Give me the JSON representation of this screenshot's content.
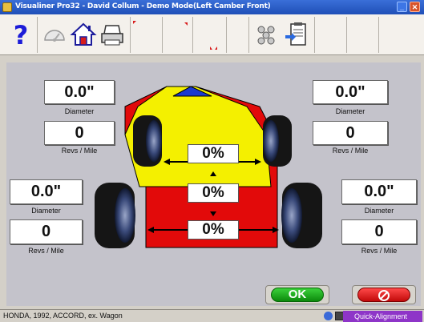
{
  "window": {
    "title": "Visualiner Pro32 - David Collum - Demo Mode(Left Camber Front)"
  },
  "toolbar": {
    "items": [
      "help-icon",
      "gauge-icon",
      "home-icon",
      "printer-icon",
      "tire-runout-icon",
      "specifications-icon"
    ]
  },
  "wheels": {
    "front_left": {
      "diameter": "0.0\"",
      "diameter_label": "Diameter",
      "revs": "0",
      "revs_label": "Revs / Mile"
    },
    "front_right": {
      "diameter": "0.0\"",
      "diameter_label": "Diameter",
      "revs": "0",
      "revs_label": "Revs / Mile"
    },
    "rear_left": {
      "diameter": "0.0\"",
      "diameter_label": "Diameter",
      "revs": "0",
      "revs_label": "Revs / Mile"
    },
    "rear_right": {
      "diameter": "0.0\"",
      "diameter_label": "Diameter",
      "revs": "0",
      "revs_label": "Revs / Mile"
    }
  },
  "percentages": {
    "front": "0%",
    "middle": "0%",
    "rear": "0%"
  },
  "buttons": {
    "ok": "OK"
  },
  "status": {
    "vehicle": "HONDA, 1992, ACCORD, ex. Wagon",
    "mode": "Quick-Alignment"
  },
  "colors": {
    "yellow": "#f4f000",
    "red": "#e20a0a",
    "blue": "#1a3ad0",
    "background": "#c4c3cb",
    "status_mode": "#8e35c8"
  }
}
